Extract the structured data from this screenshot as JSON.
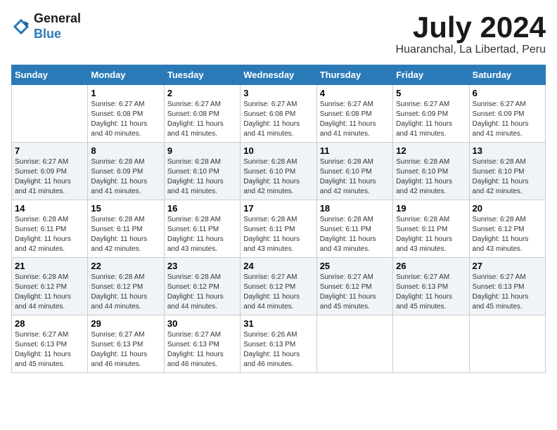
{
  "header": {
    "logo_general": "General",
    "logo_blue": "Blue",
    "main_title": "July 2024",
    "subtitle": "Huaranchal, La Libertad, Peru"
  },
  "calendar": {
    "days_of_week": [
      "Sunday",
      "Monday",
      "Tuesday",
      "Wednesday",
      "Thursday",
      "Friday",
      "Saturday"
    ],
    "weeks": [
      [
        {
          "day": "",
          "info": ""
        },
        {
          "day": "1",
          "info": "Sunrise: 6:27 AM\nSunset: 6:08 PM\nDaylight: 11 hours\nand 40 minutes."
        },
        {
          "day": "2",
          "info": "Sunrise: 6:27 AM\nSunset: 6:08 PM\nDaylight: 11 hours\nand 41 minutes."
        },
        {
          "day": "3",
          "info": "Sunrise: 6:27 AM\nSunset: 6:08 PM\nDaylight: 11 hours\nand 41 minutes."
        },
        {
          "day": "4",
          "info": "Sunrise: 6:27 AM\nSunset: 6:08 PM\nDaylight: 11 hours\nand 41 minutes."
        },
        {
          "day": "5",
          "info": "Sunrise: 6:27 AM\nSunset: 6:09 PM\nDaylight: 11 hours\nand 41 minutes."
        },
        {
          "day": "6",
          "info": "Sunrise: 6:27 AM\nSunset: 6:09 PM\nDaylight: 11 hours\nand 41 minutes."
        }
      ],
      [
        {
          "day": "7",
          "info": "Sunrise: 6:27 AM\nSunset: 6:09 PM\nDaylight: 11 hours\nand 41 minutes."
        },
        {
          "day": "8",
          "info": "Sunrise: 6:28 AM\nSunset: 6:09 PM\nDaylight: 11 hours\nand 41 minutes."
        },
        {
          "day": "9",
          "info": "Sunrise: 6:28 AM\nSunset: 6:10 PM\nDaylight: 11 hours\nand 41 minutes."
        },
        {
          "day": "10",
          "info": "Sunrise: 6:28 AM\nSunset: 6:10 PM\nDaylight: 11 hours\nand 42 minutes."
        },
        {
          "day": "11",
          "info": "Sunrise: 6:28 AM\nSunset: 6:10 PM\nDaylight: 11 hours\nand 42 minutes."
        },
        {
          "day": "12",
          "info": "Sunrise: 6:28 AM\nSunset: 6:10 PM\nDaylight: 11 hours\nand 42 minutes."
        },
        {
          "day": "13",
          "info": "Sunrise: 6:28 AM\nSunset: 6:10 PM\nDaylight: 11 hours\nand 42 minutes."
        }
      ],
      [
        {
          "day": "14",
          "info": "Sunrise: 6:28 AM\nSunset: 6:11 PM\nDaylight: 11 hours\nand 42 minutes."
        },
        {
          "day": "15",
          "info": "Sunrise: 6:28 AM\nSunset: 6:11 PM\nDaylight: 11 hours\nand 42 minutes."
        },
        {
          "day": "16",
          "info": "Sunrise: 6:28 AM\nSunset: 6:11 PM\nDaylight: 11 hours\nand 43 minutes."
        },
        {
          "day": "17",
          "info": "Sunrise: 6:28 AM\nSunset: 6:11 PM\nDaylight: 11 hours\nand 43 minutes."
        },
        {
          "day": "18",
          "info": "Sunrise: 6:28 AM\nSunset: 6:11 PM\nDaylight: 11 hours\nand 43 minutes."
        },
        {
          "day": "19",
          "info": "Sunrise: 6:28 AM\nSunset: 6:11 PM\nDaylight: 11 hours\nand 43 minutes."
        },
        {
          "day": "20",
          "info": "Sunrise: 6:28 AM\nSunset: 6:12 PM\nDaylight: 11 hours\nand 43 minutes."
        }
      ],
      [
        {
          "day": "21",
          "info": "Sunrise: 6:28 AM\nSunset: 6:12 PM\nDaylight: 11 hours\nand 44 minutes."
        },
        {
          "day": "22",
          "info": "Sunrise: 6:28 AM\nSunset: 6:12 PM\nDaylight: 11 hours\nand 44 minutes."
        },
        {
          "day": "23",
          "info": "Sunrise: 6:28 AM\nSunset: 6:12 PM\nDaylight: 11 hours\nand 44 minutes."
        },
        {
          "day": "24",
          "info": "Sunrise: 6:27 AM\nSunset: 6:12 PM\nDaylight: 11 hours\nand 44 minutes."
        },
        {
          "day": "25",
          "info": "Sunrise: 6:27 AM\nSunset: 6:12 PM\nDaylight: 11 hours\nand 45 minutes."
        },
        {
          "day": "26",
          "info": "Sunrise: 6:27 AM\nSunset: 6:13 PM\nDaylight: 11 hours\nand 45 minutes."
        },
        {
          "day": "27",
          "info": "Sunrise: 6:27 AM\nSunset: 6:13 PM\nDaylight: 11 hours\nand 45 minutes."
        }
      ],
      [
        {
          "day": "28",
          "info": "Sunrise: 6:27 AM\nSunset: 6:13 PM\nDaylight: 11 hours\nand 45 minutes."
        },
        {
          "day": "29",
          "info": "Sunrise: 6:27 AM\nSunset: 6:13 PM\nDaylight: 11 hours\nand 46 minutes."
        },
        {
          "day": "30",
          "info": "Sunrise: 6:27 AM\nSunset: 6:13 PM\nDaylight: 11 hours\nand 46 minutes."
        },
        {
          "day": "31",
          "info": "Sunrise: 6:26 AM\nSunset: 6:13 PM\nDaylight: 11 hours\nand 46 minutes."
        },
        {
          "day": "",
          "info": ""
        },
        {
          "day": "",
          "info": ""
        },
        {
          "day": "",
          "info": ""
        }
      ]
    ]
  }
}
